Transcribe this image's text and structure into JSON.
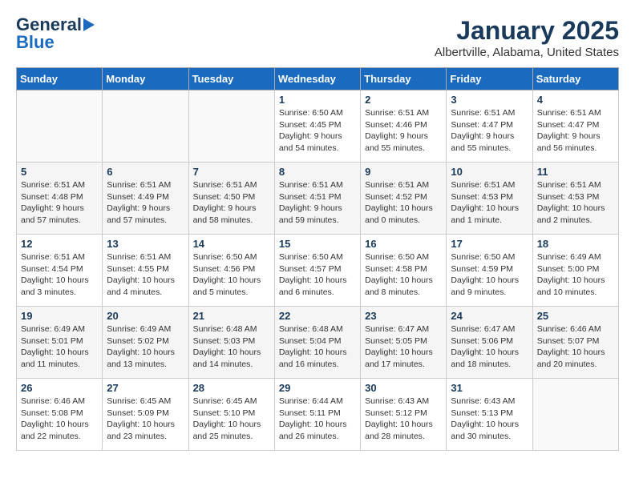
{
  "header": {
    "logo_line1": "General",
    "logo_line2": "Blue",
    "month": "January 2025",
    "location": "Albertville, Alabama, United States"
  },
  "weekdays": [
    "Sunday",
    "Monday",
    "Tuesday",
    "Wednesday",
    "Thursday",
    "Friday",
    "Saturday"
  ],
  "weeks": [
    [
      {
        "day": "",
        "info": ""
      },
      {
        "day": "",
        "info": ""
      },
      {
        "day": "",
        "info": ""
      },
      {
        "day": "1",
        "info": "Sunrise: 6:50 AM\nSunset: 4:45 PM\nDaylight: 9 hours and 54 minutes."
      },
      {
        "day": "2",
        "info": "Sunrise: 6:51 AM\nSunset: 4:46 PM\nDaylight: 9 hours and 55 minutes."
      },
      {
        "day": "3",
        "info": "Sunrise: 6:51 AM\nSunset: 4:47 PM\nDaylight: 9 hours and 55 minutes."
      },
      {
        "day": "4",
        "info": "Sunrise: 6:51 AM\nSunset: 4:47 PM\nDaylight: 9 hours and 56 minutes."
      }
    ],
    [
      {
        "day": "5",
        "info": "Sunrise: 6:51 AM\nSunset: 4:48 PM\nDaylight: 9 hours and 57 minutes."
      },
      {
        "day": "6",
        "info": "Sunrise: 6:51 AM\nSunset: 4:49 PM\nDaylight: 9 hours and 57 minutes."
      },
      {
        "day": "7",
        "info": "Sunrise: 6:51 AM\nSunset: 4:50 PM\nDaylight: 9 hours and 58 minutes."
      },
      {
        "day": "8",
        "info": "Sunrise: 6:51 AM\nSunset: 4:51 PM\nDaylight: 9 hours and 59 minutes."
      },
      {
        "day": "9",
        "info": "Sunrise: 6:51 AM\nSunset: 4:52 PM\nDaylight: 10 hours and 0 minutes."
      },
      {
        "day": "10",
        "info": "Sunrise: 6:51 AM\nSunset: 4:53 PM\nDaylight: 10 hours and 1 minute."
      },
      {
        "day": "11",
        "info": "Sunrise: 6:51 AM\nSunset: 4:53 PM\nDaylight: 10 hours and 2 minutes."
      }
    ],
    [
      {
        "day": "12",
        "info": "Sunrise: 6:51 AM\nSunset: 4:54 PM\nDaylight: 10 hours and 3 minutes."
      },
      {
        "day": "13",
        "info": "Sunrise: 6:51 AM\nSunset: 4:55 PM\nDaylight: 10 hours and 4 minutes."
      },
      {
        "day": "14",
        "info": "Sunrise: 6:50 AM\nSunset: 4:56 PM\nDaylight: 10 hours and 5 minutes."
      },
      {
        "day": "15",
        "info": "Sunrise: 6:50 AM\nSunset: 4:57 PM\nDaylight: 10 hours and 6 minutes."
      },
      {
        "day": "16",
        "info": "Sunrise: 6:50 AM\nSunset: 4:58 PM\nDaylight: 10 hours and 8 minutes."
      },
      {
        "day": "17",
        "info": "Sunrise: 6:50 AM\nSunset: 4:59 PM\nDaylight: 10 hours and 9 minutes."
      },
      {
        "day": "18",
        "info": "Sunrise: 6:49 AM\nSunset: 5:00 PM\nDaylight: 10 hours and 10 minutes."
      }
    ],
    [
      {
        "day": "19",
        "info": "Sunrise: 6:49 AM\nSunset: 5:01 PM\nDaylight: 10 hours and 11 minutes."
      },
      {
        "day": "20",
        "info": "Sunrise: 6:49 AM\nSunset: 5:02 PM\nDaylight: 10 hours and 13 minutes."
      },
      {
        "day": "21",
        "info": "Sunrise: 6:48 AM\nSunset: 5:03 PM\nDaylight: 10 hours and 14 minutes."
      },
      {
        "day": "22",
        "info": "Sunrise: 6:48 AM\nSunset: 5:04 PM\nDaylight: 10 hours and 16 minutes."
      },
      {
        "day": "23",
        "info": "Sunrise: 6:47 AM\nSunset: 5:05 PM\nDaylight: 10 hours and 17 minutes."
      },
      {
        "day": "24",
        "info": "Sunrise: 6:47 AM\nSunset: 5:06 PM\nDaylight: 10 hours and 18 minutes."
      },
      {
        "day": "25",
        "info": "Sunrise: 6:46 AM\nSunset: 5:07 PM\nDaylight: 10 hours and 20 minutes."
      }
    ],
    [
      {
        "day": "26",
        "info": "Sunrise: 6:46 AM\nSunset: 5:08 PM\nDaylight: 10 hours and 22 minutes."
      },
      {
        "day": "27",
        "info": "Sunrise: 6:45 AM\nSunset: 5:09 PM\nDaylight: 10 hours and 23 minutes."
      },
      {
        "day": "28",
        "info": "Sunrise: 6:45 AM\nSunset: 5:10 PM\nDaylight: 10 hours and 25 minutes."
      },
      {
        "day": "29",
        "info": "Sunrise: 6:44 AM\nSunset: 5:11 PM\nDaylight: 10 hours and 26 minutes."
      },
      {
        "day": "30",
        "info": "Sunrise: 6:43 AM\nSunset: 5:12 PM\nDaylight: 10 hours and 28 minutes."
      },
      {
        "day": "31",
        "info": "Sunrise: 6:43 AM\nSunset: 5:13 PM\nDaylight: 10 hours and 30 minutes."
      },
      {
        "day": "",
        "info": ""
      }
    ]
  ]
}
